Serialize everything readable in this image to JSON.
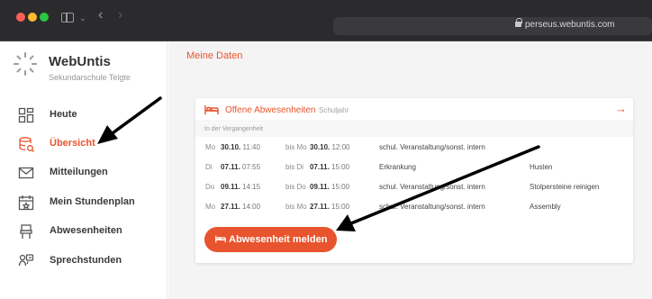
{
  "browser": {
    "url": "perseus.webuntis.com"
  },
  "sidebar": {
    "brand": "WebUntis",
    "school": "Sekundarschule Telgte",
    "items": [
      {
        "label": "Heute",
        "icon": "dashboard-icon"
      },
      {
        "label": "Übersicht",
        "icon": "overview-icon",
        "active": true
      },
      {
        "label": "Mitteilungen",
        "icon": "mail-icon"
      },
      {
        "label": "Mein Stundenplan",
        "icon": "calendar-icon"
      },
      {
        "label": "Abwesenheiten",
        "icon": "chair-icon"
      },
      {
        "label": "Sprechstunden",
        "icon": "consultation-icon"
      }
    ]
  },
  "main": {
    "title": "Meine Daten",
    "card": {
      "title": "Offene Abwesenheiten",
      "subtitle": "Schuljahr",
      "section": "In der Vergangenheit",
      "bis": "bis",
      "rows": [
        {
          "d1": "Mo",
          "date1": "30.10.",
          "time1": "11:40",
          "d2": "Mo",
          "date2": "30.10.",
          "time2": "12:00",
          "type": "schul. Veranstaltung/sonst. intern",
          "note": ""
        },
        {
          "d1": "Di",
          "date1": "07.11.",
          "time1": "07:55",
          "d2": "Di",
          "date2": "07.11.",
          "time2": "15:00",
          "type": "Erkrankung",
          "note": "Husten"
        },
        {
          "d1": "Do",
          "date1": "09.11.",
          "time1": "14:15",
          "d2": "Do",
          "date2": "09.11.",
          "time2": "15:00",
          "type": "schul. Veranstaltung/sonst. intern",
          "note": "Stolpersteine reinigen"
        },
        {
          "d1": "Mo",
          "date1": "27.11.",
          "time1": "14:00",
          "d2": "Mo",
          "date2": "27.11.",
          "time2": "15:00",
          "type": "schul. Veranstaltung/sonst. intern",
          "note": "Assembly"
        }
      ],
      "button_label": "Abwesenheit melden"
    }
  },
  "colors": {
    "accent": "#e8542d",
    "chrome": "#2b2b2d",
    "sidebar_text": "#3a3a3a"
  }
}
